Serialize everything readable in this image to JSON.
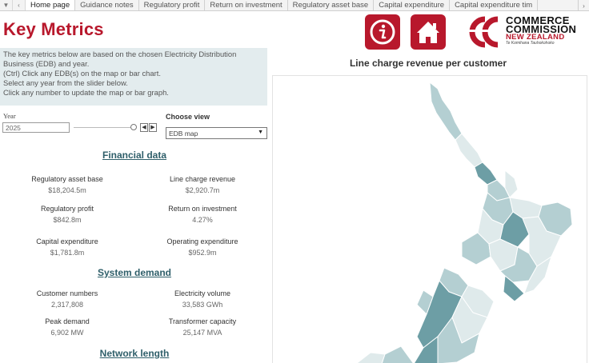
{
  "tabs": {
    "items": [
      {
        "label": "Home page",
        "active": true
      },
      {
        "label": "Guidance notes",
        "active": false
      },
      {
        "label": "Regulatory profit",
        "active": false
      },
      {
        "label": "Return on investment",
        "active": false
      },
      {
        "label": "Regulatory asset base",
        "active": false
      },
      {
        "label": "Capital expenditure",
        "active": false
      },
      {
        "label": "Capital expenditure tim",
        "active": false
      }
    ]
  },
  "header": {
    "title": "Key Metrics"
  },
  "intro": {
    "lines": [
      "The key metrics below are based on the chosen Electricity Distribution",
      "Business (EDB) and year.",
      "(Ctrl) Click any EDB(s) on the map or bar chart.",
      "Select any year from the slider below.",
      "Click any number to update the map or bar graph."
    ]
  },
  "controls": {
    "year_label": "Year",
    "year_value": "2025",
    "view_label": "Choose view",
    "view_value": "EDB map"
  },
  "financial": {
    "heading": "Financial data",
    "metrics": [
      {
        "label": "Regulatory asset base",
        "value": "$18,204.5m"
      },
      {
        "label": "Line charge revenue",
        "value": "$2,920.7m"
      },
      {
        "label": "Regulatory profit",
        "value": "$842.8m"
      },
      {
        "label": "Return on investment",
        "value": "4.27%"
      },
      {
        "label": "Capital expenditure",
        "value": "$1,781.8m"
      },
      {
        "label": "Operating expenditure",
        "value": "$952.9m"
      }
    ]
  },
  "system": {
    "heading": "System demand",
    "metrics": [
      {
        "label": "Customer numbers",
        "value": "2,317,808"
      },
      {
        "label": "Electricity volume",
        "value": "33,583 GWh"
      },
      {
        "label": "Peak demand",
        "value": "6,902 MW"
      },
      {
        "label": "Transformer capacity",
        "value": "25,147 MVA"
      }
    ]
  },
  "network": {
    "heading": "Network length"
  },
  "logo": {
    "line1": "COMMERCE",
    "line2": "COMMISSION",
    "line3": "NEW ZEALAND",
    "line4": "Te Komihana Tauhokohoko"
  },
  "map": {
    "title": "Line charge revenue per customer"
  },
  "colors": {
    "brand_red": "#b8182c",
    "heading_teal": "#2f5f6a",
    "info_bg": "#e3ecee",
    "map_light": "#dfeaeb",
    "map_mid": "#b4cfd2",
    "map_dark": "#6d9ea5"
  },
  "icons": [
    "dropdown-arrow-icon",
    "scroll-left-icon",
    "scroll-right-icon",
    "info-icon",
    "home-icon",
    "step-back-icon",
    "step-forward-icon",
    "logo-icon"
  ]
}
